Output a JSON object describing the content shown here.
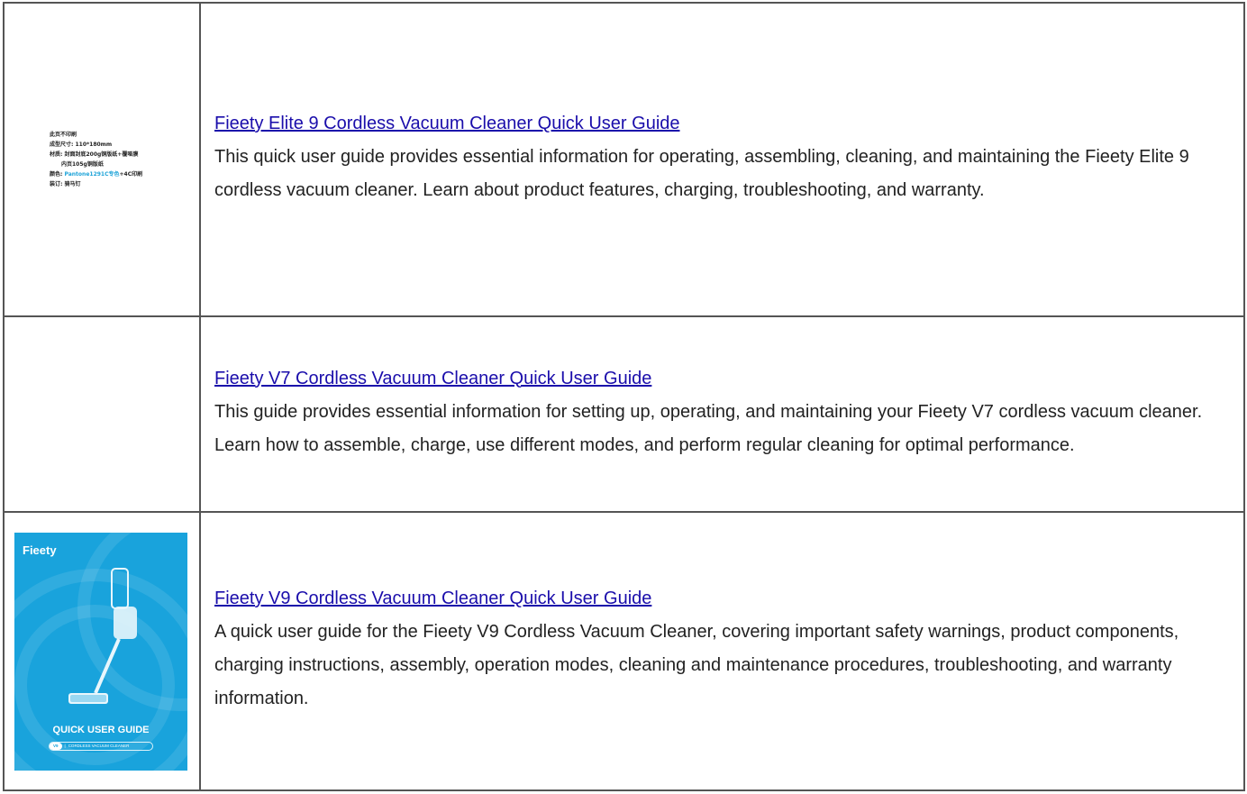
{
  "rows": [
    {
      "title": "Fieety Elite 9 Cordless Vacuum Cleaner Quick User Guide",
      "description": "This quick user guide provides essential information for operating, assembling, cleaning, and maintaining the Fieety Elite 9 cordless vacuum cleaner. Learn about product features, charging, troubleshooting, and warranty.",
      "print_notes": {
        "line1": "此页不印刷",
        "line2": "成型尺寸: 110*180mm",
        "line3": "材质: 封面封底200g铜版纸+覆哑膜",
        "line4": "内页105g铜版纸",
        "line5_prefix": "颜色: ",
        "line5_color": "Pantone1291C专色",
        "line5_suffix": "+4C印刷",
        "line6": "装订: 骑马钉"
      }
    },
    {
      "title": "Fieety V7 Cordless Vacuum Cleaner Quick User Guide",
      "description": "This guide provides essential information for setting up, operating, and maintaining your Fieety V7 cordless vacuum cleaner. Learn how to assemble, charge, use different modes, and perform regular cleaning for optimal performance."
    },
    {
      "title": "Fieety V9 Cordless Vacuum Cleaner Quick User Guide",
      "description": "A quick user guide for the Fieety V9 Cordless Vacuum Cleaner, covering important safety warnings, product components, charging instructions, assembly, operation modes, cleaning and maintenance procedures, troubleshooting, and warranty information.",
      "cover": {
        "brand": "Fieety",
        "heading": "QUICK USER GUIDE",
        "model": "V9",
        "separator": "|",
        "product": "CORDLESS VACUUM CLEANER",
        "background_color": "#19a3dc"
      }
    }
  ],
  "colors": {
    "link": "#1a0dab",
    "border": "#555555",
    "text": "#222222"
  }
}
